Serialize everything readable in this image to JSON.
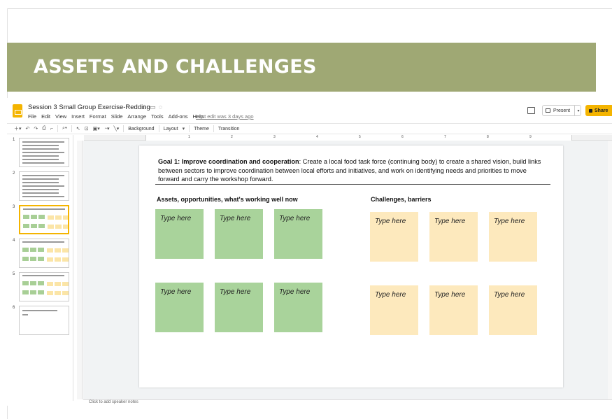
{
  "banner": {
    "title": "ASSETS AND CHALLENGES"
  },
  "app": {
    "doc_title": "Session 3 Small Group Exercise-Redding",
    "title_icons": [
      "star-icon",
      "folder-icon",
      "cloud-icon"
    ],
    "menu": [
      "File",
      "Edit",
      "View",
      "Insert",
      "Format",
      "Slide",
      "Arrange",
      "Tools",
      "Add-ons",
      "Help"
    ],
    "last_edit": "Last edit was 3 days ago",
    "present_label": "Present",
    "share_label": "Share",
    "accent": "#f4b400"
  },
  "toolbar": {
    "background": "Background",
    "layout": "Layout",
    "theme": "Theme",
    "transition": "Transition"
  },
  "ruler": {
    "numbers": [
      "1",
      "2",
      "3",
      "4",
      "5",
      "6",
      "7",
      "8",
      "9"
    ]
  },
  "filmstrip": {
    "slides": [
      {
        "num": "1",
        "active": false
      },
      {
        "num": "2",
        "active": false
      },
      {
        "num": "3",
        "active": true
      },
      {
        "num": "4",
        "active": false
      },
      {
        "num": "5",
        "active": false
      },
      {
        "num": "6",
        "active": false
      }
    ]
  },
  "slide": {
    "goal_bold": "Goal 1: Improve coordination and cooperation",
    "goal_rest": ": Create a local food task force (continuing body) to create a shared vision, build links between sectors to improve coordination between local efforts and initiatives, and work on identifying needs and priorities to move forward and carry the workshop forward.",
    "assets_heading": "Assets, opportunities, what's working well now",
    "challenges_heading": "Challenges, barriers",
    "note_text": "Type here",
    "colors": {
      "assets": "#a9d39b",
      "challenges": "#fde9bd",
      "banner": "#9fa874"
    }
  },
  "notes_bar": {
    "text": "Click to add speaker notes"
  }
}
